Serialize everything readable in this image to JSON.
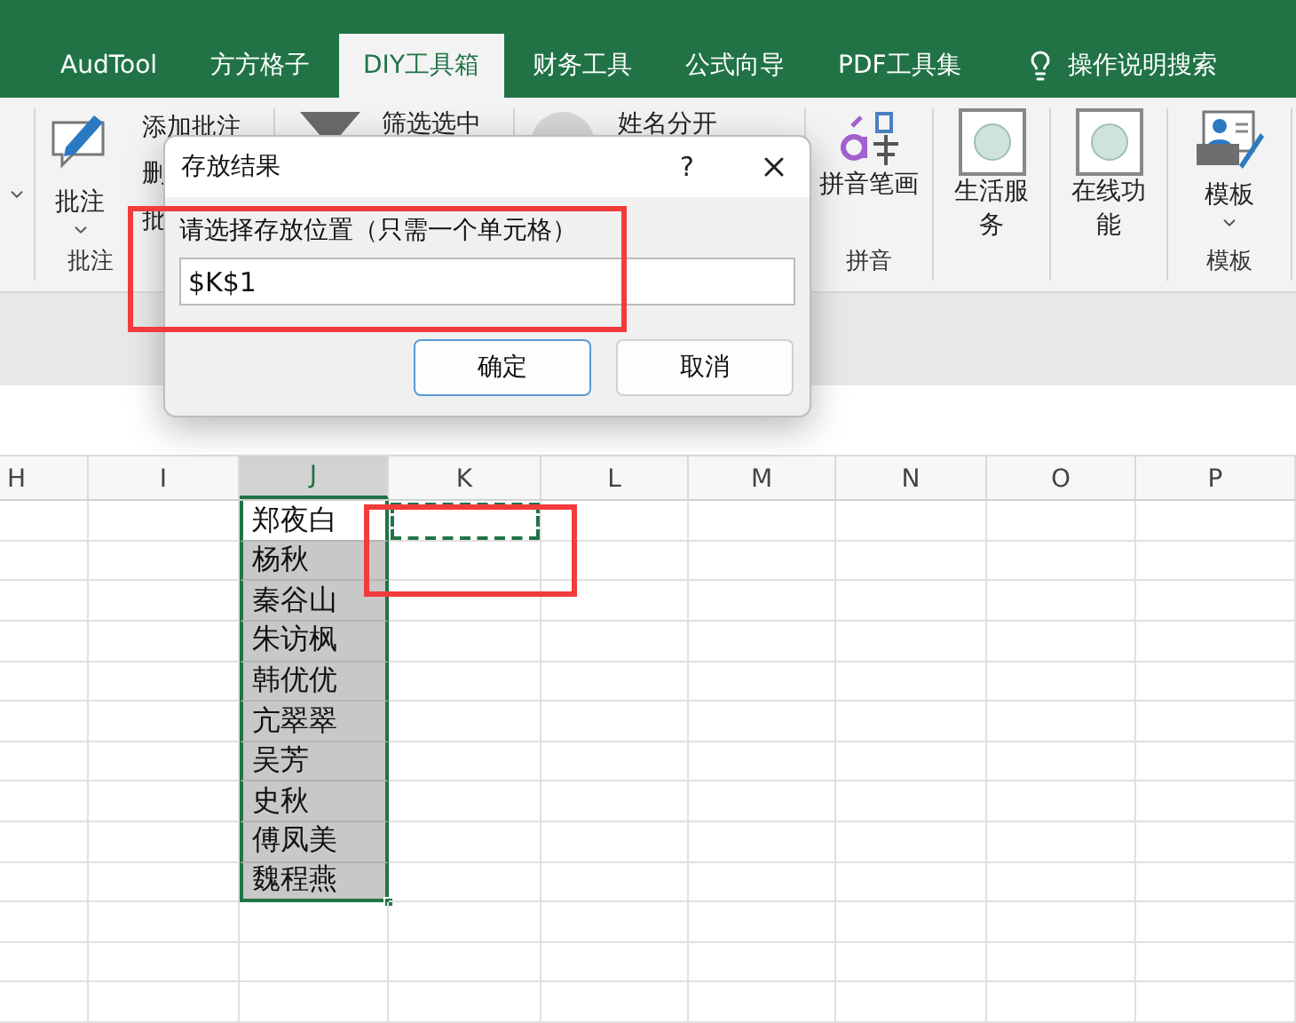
{
  "tabs": [
    {
      "label": "AudTool",
      "selected": false
    },
    {
      "label": "方方格子",
      "selected": false
    },
    {
      "label": "DIY工具箱",
      "selected": true
    },
    {
      "label": "财务工具",
      "selected": false
    },
    {
      "label": "公式向导",
      "selected": false
    },
    {
      "label": "PDF工具集",
      "selected": false
    }
  ],
  "search": {
    "label": "操作说明搜索"
  },
  "ribbon": {
    "comment_group": {
      "big_button": "批注",
      "small_buttons": [
        "添加批注",
        "删",
        "批"
      ],
      "label": "批注"
    },
    "filter_group": {
      "button": "筛选选中"
    },
    "name_group": {
      "button": "姓名分开"
    },
    "pinyin_group": {
      "button": "拼音笔画",
      "label": "拼音"
    },
    "life_group": {
      "button": "生活服务"
    },
    "online_group": {
      "button": "在线功能"
    },
    "template_group": {
      "button": "模板",
      "label": "模板"
    }
  },
  "dialog": {
    "title": "存放结果",
    "help": "?",
    "prompt": "请选择存放位置（只需一个单元格）",
    "value": "$K$1",
    "buttons": [
      {
        "label": "确定",
        "default": true
      },
      {
        "label": "取消",
        "default": false
      }
    ]
  },
  "sheet": {
    "columns": [
      {
        "label": "H",
        "selected": false,
        "copy_marquee": false
      },
      {
        "label": "I",
        "selected": false,
        "copy_marquee": false
      },
      {
        "label": "J",
        "selected": true,
        "copy_marquee": false
      },
      {
        "label": "K",
        "selected": false,
        "copy_marquee": true
      },
      {
        "label": "L",
        "selected": false,
        "copy_marquee": false
      },
      {
        "label": "M",
        "selected": false,
        "copy_marquee": false
      },
      {
        "label": "N",
        "selected": false,
        "copy_marquee": false
      },
      {
        "label": "O",
        "selected": false,
        "copy_marquee": false
      },
      {
        "label": "P",
        "selected": false,
        "copy_marquee": false
      }
    ],
    "names": [
      {
        "text": "郑夜白",
        "active": true
      },
      {
        "text": "杨秋",
        "active": false
      },
      {
        "text": "秦谷山",
        "active": false
      },
      {
        "text": "朱访枫",
        "active": false
      },
      {
        "text": "韩优优",
        "active": false
      },
      {
        "text": "亢翠翠",
        "active": false
      },
      {
        "text": "吴芳",
        "active": false
      },
      {
        "text": "史秋",
        "active": false
      },
      {
        "text": "傅凤美",
        "active": false
      },
      {
        "text": "魏程燕",
        "active": false
      }
    ]
  },
  "annotations": {
    "dialog_field_highlight": true,
    "target_cell_highlight": true
  }
}
